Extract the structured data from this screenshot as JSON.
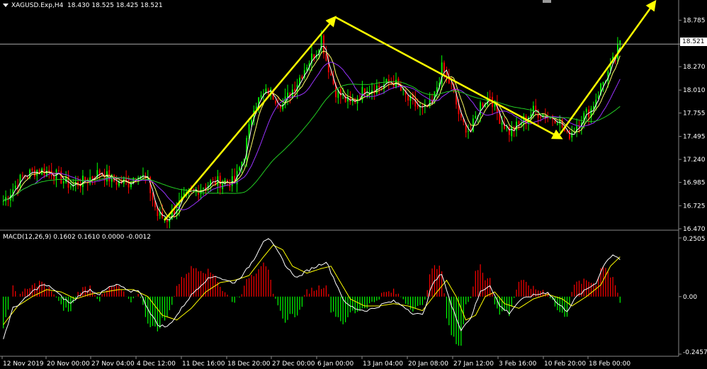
{
  "header": {
    "symbol_info": "XAGUSD.Exp,H4",
    "ohlc": "18.430 18.525 18.425 18.521"
  },
  "macd_header": "MACD(12,26,9) 0.1602 0.1610 0.0000 -0.0012",
  "current_price": "18.521",
  "colors": {
    "background": "#000000",
    "bull_candle": "#00ff00",
    "bear_candle": "#ff0000",
    "arrow": "#ffff00",
    "ma_fast": "#ffffff",
    "ma_mid": "#ffff66",
    "ma_slow": "#9933ff",
    "ma_long": "#22cc22",
    "macd_main": "#ffffff",
    "macd_signal": "#ffff00"
  },
  "chart_data": [
    {
      "type": "candlestick",
      "title": "",
      "y_ticks": [
        "18.785",
        "18.521",
        "18.270",
        "18.010",
        "17.755",
        "17.495",
        "17.240",
        "16.985",
        "16.725",
        "16.470"
      ],
      "ylim": [
        16.47,
        18.9
      ],
      "x_ticks": [
        "12 Nov 2019",
        "20 Nov 00:00",
        "27 Nov 04:00",
        "4 Dec 12:00",
        "11 Dec 16:00",
        "18 Dec 20:00",
        "27 Dec 00:00",
        "6 Jan 00:00",
        "13 Jan 04:00",
        "20 Jan 08:00",
        "27 Jan 12:00",
        "3 Feb 16:00",
        "10 Feb 20:00",
        "18 Feb 00:00"
      ],
      "close_anchors": [
        [
          0,
          16.78
        ],
        [
          8,
          17.05
        ],
        [
          14,
          17.12
        ],
        [
          20,
          17.1
        ],
        [
          28,
          16.95
        ],
        [
          34,
          17.0
        ],
        [
          40,
          17.1
        ],
        [
          46,
          17.0
        ],
        [
          52,
          16.98
        ],
        [
          56,
          17.1
        ],
        [
          60,
          16.98
        ],
        [
          64,
          16.62
        ],
        [
          68,
          16.58
        ],
        [
          74,
          16.78
        ],
        [
          80,
          16.9
        ],
        [
          86,
          16.98
        ],
        [
          92,
          17.0
        ],
        [
          96,
          16.98
        ],
        [
          100,
          17.3
        ],
        [
          104,
          17.85
        ],
        [
          110,
          18.0
        ],
        [
          116,
          17.85
        ],
        [
          122,
          18.1
        ],
        [
          126,
          18.3
        ],
        [
          130,
          18.45
        ],
        [
          132,
          18.6
        ],
        [
          134,
          18.35
        ],
        [
          138,
          18.0
        ],
        [
          144,
          17.85
        ],
        [
          150,
          18.02
        ],
        [
          156,
          18.05
        ],
        [
          162,
          18.1
        ],
        [
          168,
          17.9
        ],
        [
          174,
          17.78
        ],
        [
          178,
          17.85
        ],
        [
          182,
          18.25
        ],
        [
          186,
          18.05
        ],
        [
          190,
          17.65
        ],
        [
          194,
          17.55
        ],
        [
          198,
          17.85
        ],
        [
          202,
          17.95
        ],
        [
          206,
          17.7
        ],
        [
          210,
          17.55
        ],
        [
          214,
          17.62
        ],
        [
          220,
          17.78
        ],
        [
          226,
          17.72
        ],
        [
          230,
          17.7
        ],
        [
          234,
          17.5
        ],
        [
          236,
          17.55
        ],
        [
          240,
          17.7
        ],
        [
          244,
          17.8
        ],
        [
          248,
          18.05
        ],
        [
          252,
          18.25
        ],
        [
          256,
          18.52
        ]
      ],
      "moving_averages": [
        "fast",
        "mid",
        "slow",
        "long"
      ],
      "annotations": "yellow trend arrows: up, down, up"
    },
    {
      "type": "macd",
      "params": "12,26,9",
      "y_ticks": [
        "0.2505",
        "0.00",
        "-0.2457"
      ],
      "ylim": [
        -0.2457,
        0.2505
      ],
      "main_anchors": [
        [
          0,
          -0.18
        ],
        [
          4,
          -0.05
        ],
        [
          8,
          -0.02
        ],
        [
          12,
          0.02
        ],
        [
          16,
          0.05
        ],
        [
          20,
          0.04
        ],
        [
          24,
          0.0
        ],
        [
          28,
          -0.03
        ],
        [
          32,
          0.01
        ],
        [
          36,
          0.03
        ],
        [
          40,
          0.01
        ],
        [
          44,
          0.04
        ],
        [
          48,
          0.05
        ],
        [
          52,
          0.02
        ],
        [
          56,
          0.03
        ],
        [
          60,
          -0.05
        ],
        [
          64,
          -0.12
        ],
        [
          68,
          -0.13
        ],
        [
          72,
          -0.08
        ],
        [
          76,
          -0.02
        ],
        [
          80,
          0.03
        ],
        [
          84,
          0.07
        ],
        [
          88,
          0.09
        ],
        [
          92,
          0.07
        ],
        [
          96,
          0.06
        ],
        [
          100,
          0.1
        ],
        [
          104,
          0.16
        ],
        [
          108,
          0.24
        ],
        [
          110,
          0.25
        ],
        [
          114,
          0.19
        ],
        [
          118,
          0.12
        ],
        [
          122,
          0.08
        ],
        [
          126,
          0.11
        ],
        [
          130,
          0.13
        ],
        [
          134,
          0.15
        ],
        [
          138,
          0.06
        ],
        [
          142,
          -0.03
        ],
        [
          146,
          -0.05
        ],
        [
          150,
          -0.06
        ],
        [
          154,
          -0.05
        ],
        [
          158,
          -0.03
        ],
        [
          162,
          -0.02
        ],
        [
          166,
          -0.04
        ],
        [
          170,
          -0.07
        ],
        [
          174,
          -0.08
        ],
        [
          178,
          0.05
        ],
        [
          182,
          0.1
        ],
        [
          186,
          -0.04
        ],
        [
          190,
          -0.14
        ],
        [
          194,
          -0.09
        ],
        [
          198,
          0.02
        ],
        [
          202,
          0.05
        ],
        [
          206,
          -0.04
        ],
        [
          210,
          -0.07
        ],
        [
          214,
          -0.02
        ],
        [
          218,
          0.0
        ],
        [
          222,
          0.01
        ],
        [
          226,
          0.02
        ],
        [
          230,
          -0.03
        ],
        [
          234,
          -0.06
        ],
        [
          238,
          0.0
        ],
        [
          242,
          0.03
        ],
        [
          246,
          0.06
        ],
        [
          250,
          0.15
        ],
        [
          253,
          0.18
        ],
        [
          256,
          0.16
        ]
      ],
      "signal_anchors": [
        [
          0,
          -0.12
        ],
        [
          6,
          -0.04
        ],
        [
          12,
          0.0
        ],
        [
          18,
          0.03
        ],
        [
          24,
          0.02
        ],
        [
          30,
          -0.01
        ],
        [
          36,
          0.01
        ],
        [
          42,
          0.02
        ],
        [
          48,
          0.03
        ],
        [
          54,
          0.03
        ],
        [
          60,
          0.0
        ],
        [
          66,
          -0.08
        ],
        [
          72,
          -0.1
        ],
        [
          78,
          -0.05
        ],
        [
          84,
          0.02
        ],
        [
          90,
          0.06
        ],
        [
          96,
          0.07
        ],
        [
          102,
          0.09
        ],
        [
          108,
          0.17
        ],
        [
          112,
          0.22
        ],
        [
          116,
          0.2
        ],
        [
          120,
          0.13
        ],
        [
          126,
          0.1
        ],
        [
          132,
          0.12
        ],
        [
          136,
          0.13
        ],
        [
          140,
          0.06
        ],
        [
          144,
          -0.01
        ],
        [
          150,
          -0.04
        ],
        [
          156,
          -0.04
        ],
        [
          162,
          -0.03
        ],
        [
          168,
          -0.04
        ],
        [
          174,
          -0.06
        ],
        [
          180,
          0.02
        ],
        [
          184,
          0.07
        ],
        [
          188,
          0.0
        ],
        [
          192,
          -0.1
        ],
        [
          196,
          -0.08
        ],
        [
          200,
          0.0
        ],
        [
          204,
          0.02
        ],
        [
          208,
          -0.03
        ],
        [
          214,
          -0.05
        ],
        [
          220,
          -0.01
        ],
        [
          226,
          0.01
        ],
        [
          232,
          -0.01
        ],
        [
          236,
          -0.04
        ],
        [
          242,
          0.0
        ],
        [
          248,
          0.05
        ],
        [
          252,
          0.13
        ],
        [
          256,
          0.17
        ]
      ]
    }
  ]
}
